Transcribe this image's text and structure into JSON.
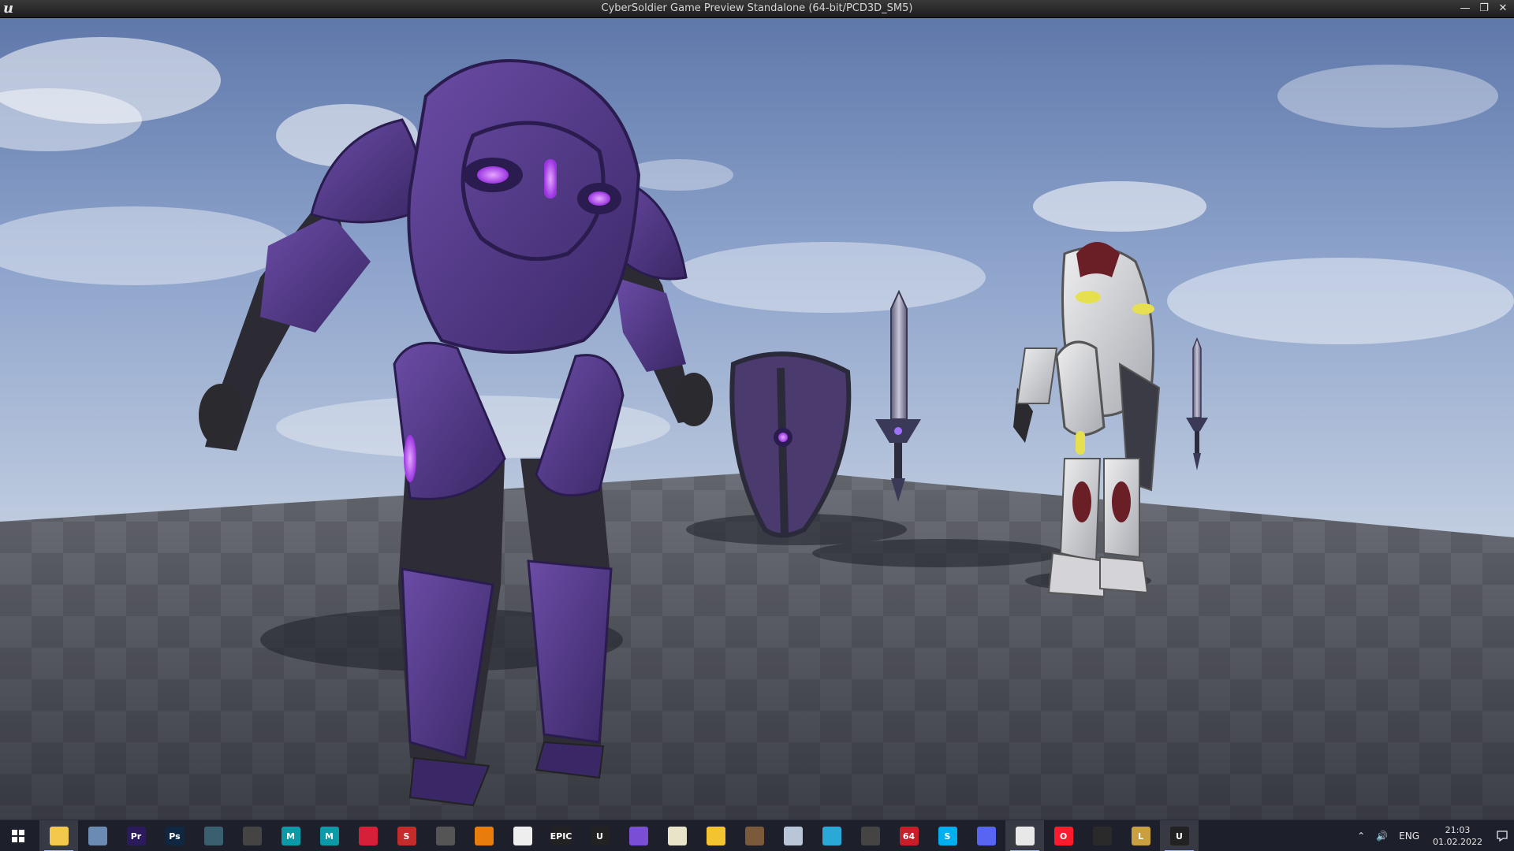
{
  "window": {
    "title": "CyberSoldier Game Preview Standalone (64-bit/PCD3D_SM5)",
    "logo_icon": "unreal-engine-logo-icon",
    "controls": {
      "minimize_icon": "minimize-icon",
      "restore_icon": "restore-icon",
      "close_icon": "close-icon"
    }
  },
  "scene": {
    "objects": [
      {
        "name": "purple-armored-soldier-model",
        "color": "#5a3c8c"
      },
      {
        "name": "shield-model",
        "color": "#4a3a6e"
      },
      {
        "name": "sword-model",
        "color": "#7a7896"
      },
      {
        "name": "white-armored-soldier-model",
        "color": "#c9cacd"
      },
      {
        "name": "small-sword-model",
        "color": "#8a8aa0"
      }
    ],
    "sky_color": "#8ea4cc",
    "floor_color": "#4b4d57"
  },
  "taskbar": {
    "start_icon": "windows-start-icon",
    "apps": [
      {
        "icon": "file-explorer-icon",
        "label": "",
        "color": "#f2c94c",
        "active": true
      },
      {
        "icon": "calculator-icon",
        "label": "",
        "color": "#6b8bb5",
        "active": false
      },
      {
        "icon": "premiere-pro-icon",
        "label": "Pr",
        "color": "#2b1b5c",
        "active": false
      },
      {
        "icon": "photoshop-icon",
        "label": "Ps",
        "color": "#0f2740",
        "active": false
      },
      {
        "icon": "marmoset-toolbag-icon",
        "label": "",
        "color": "#3a6070",
        "active": false
      },
      {
        "icon": "zbrush-icon",
        "label": "",
        "color": "#444",
        "active": false
      },
      {
        "icon": "maya-icon",
        "label": "M",
        "color": "#0c9aa8",
        "active": false
      },
      {
        "icon": "maya-secondary-icon",
        "label": "M",
        "color": "#0c9aa8",
        "active": false
      },
      {
        "icon": "heart-app-icon",
        "label": "",
        "color": "#d6203a",
        "active": false
      },
      {
        "icon": "substance-icon",
        "label": "S",
        "color": "#c42b2b",
        "active": false
      },
      {
        "icon": "search-app-icon",
        "label": "",
        "color": "#555",
        "active": false
      },
      {
        "icon": "blender-icon",
        "label": "",
        "color": "#e87d0d",
        "active": false
      },
      {
        "icon": "visual-studio-code-icon",
        "label": "",
        "color": "#eeeeee",
        "active": false
      },
      {
        "icon": "epic-games-launcher-icon",
        "label": "EPIC",
        "color": "#222",
        "active": false
      },
      {
        "icon": "unreal-engine-icon",
        "label": "U",
        "color": "#222",
        "active": false
      },
      {
        "icon": "affinity-app-icon",
        "label": "",
        "color": "#7a4fd6",
        "active": false
      },
      {
        "icon": "notes-app-icon",
        "label": "",
        "color": "#e8e4c8",
        "active": false
      },
      {
        "icon": "emoji-app-icon",
        "label": "",
        "color": "#f4c430",
        "active": false
      },
      {
        "icon": "hat-app-icon",
        "label": "",
        "color": "#7a5a3a",
        "active": false
      },
      {
        "icon": "jar-app-icon",
        "label": "",
        "color": "#b9c6d8",
        "active": false
      },
      {
        "icon": "timer-app-icon",
        "label": "",
        "color": "#2aa8d8",
        "active": false
      },
      {
        "icon": "gamepad-app-icon",
        "label": "",
        "color": "#444",
        "active": false
      },
      {
        "icon": "app-64-icon",
        "label": "64",
        "color": "#c81e2a",
        "active": false
      },
      {
        "icon": "skype-icon",
        "label": "S",
        "color": "#00aff0",
        "active": false
      },
      {
        "icon": "discord-icon",
        "label": "",
        "color": "#5865f2",
        "active": false
      },
      {
        "icon": "yandex-browser-icon",
        "label": "",
        "color": "#e8e8e8",
        "active": true
      },
      {
        "icon": "opera-icon",
        "label": "O",
        "color": "#ff1b2d",
        "active": false
      },
      {
        "icon": "steam-icon",
        "label": "",
        "color": "#2a2a2a",
        "active": false
      },
      {
        "icon": "league-of-legends-icon",
        "label": "L",
        "color": "#c8a040",
        "active": false
      },
      {
        "icon": "unreal-editor-icon",
        "label": "U",
        "color": "#222",
        "active": true
      }
    ],
    "tray": {
      "chevron_icon": "chevron-up-icon",
      "volume_icon": "volume-icon",
      "language": "ENG",
      "time": "21:03",
      "date": "01.02.2022",
      "notification_icon": "notification-icon"
    }
  }
}
